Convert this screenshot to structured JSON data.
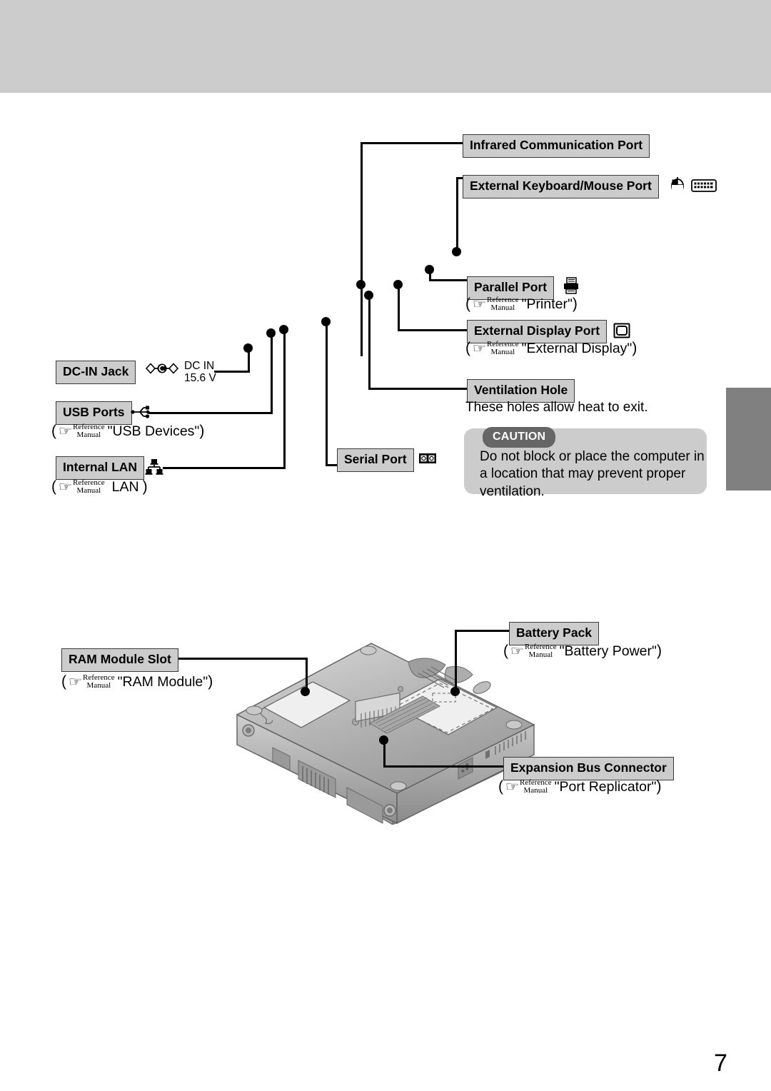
{
  "page": {
    "number": "7",
    "band_color": "#cccccc",
    "tab_color": "#808080"
  },
  "reference": {
    "line1": "Reference",
    "line2": "Manual",
    "open_paren": "(",
    "close_paren": ")",
    "hand_icon": "pointing-hand-icon"
  },
  "top_diagram": {
    "labels": {
      "infrared": "Infrared Communication Port",
      "keyboard_mouse": "External Keyboard/Mouse Port",
      "parallel": "Parallel Port",
      "external_display": "External Display Port",
      "ventilation": "Ventilation Hole",
      "serial": "Serial Port",
      "dc_in": "DC-IN Jack",
      "usb": "USB Ports",
      "lan": "Internal LAN"
    },
    "notes": {
      "parallel_ref": "\"Printer\"",
      "display_ref": "\"External Display\"",
      "usb_ref": "\"USB Devices\"",
      "lan_ref": "LAN"
    },
    "ventilation_text": "These holes allow heat to exit.",
    "dc_rating": {
      "line1": "DC IN",
      "line2": "15.6 V"
    },
    "caution": {
      "badge": "CAUTION",
      "text": "Do not block or place the computer in a location that may prevent proper ventilation."
    },
    "icons": {
      "mouse": "mouse-icon",
      "keyboard": "keyboard-icon",
      "printer": "printer-icon",
      "display": "display-icon",
      "serial": "serial-connector-icon",
      "dc_polarity": "dc-polarity-icon",
      "usb": "usb-icon",
      "lan": "lan-network-icon"
    }
  },
  "bottom_diagram": {
    "labels": {
      "ram": "RAM Module Slot",
      "battery": "Battery Pack",
      "expansion": "Expansion Bus Connector"
    },
    "notes": {
      "ram_ref": "\"RAM Module\"",
      "battery_ref": "\"Battery Power\"",
      "expansion_ref": "\"Port Replicator\""
    },
    "illustration": "laptop-underside-illustration"
  }
}
